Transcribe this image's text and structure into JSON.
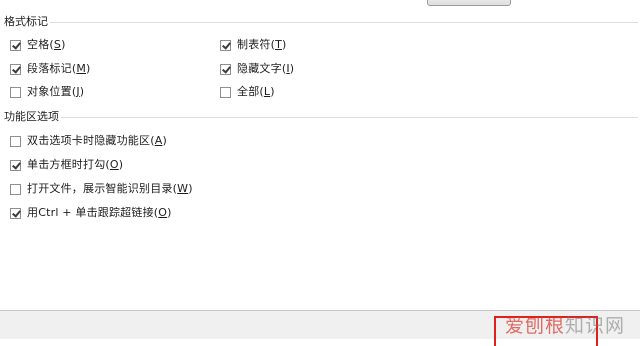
{
  "sections": {
    "format_marks": {
      "title": "格式标记",
      "options": [
        {
          "text": "空格",
          "key": "S",
          "checked": true
        },
        {
          "text": "制表符",
          "key": "T",
          "checked": true
        },
        {
          "text": "段落标记",
          "key": "M",
          "checked": true
        },
        {
          "text": "隐藏文字",
          "key": "I",
          "checked": true
        },
        {
          "text": "对象位置",
          "key": "J",
          "checked": false
        },
        {
          "text": "全部",
          "key": "L",
          "checked": false
        }
      ]
    },
    "feature_options": {
      "title": "功能区选项",
      "options": [
        {
          "text": "双击选项卡时隐藏功能区",
          "key": "A",
          "checked": false
        },
        {
          "text": "单击方框时打勾",
          "key": "O",
          "checked": true
        },
        {
          "text": "打开文件，展示智能识别目录",
          "key": "W",
          "checked": false
        },
        {
          "text": "用Ctrl + 单击跟踪超链接",
          "key": "O",
          "checked": true
        }
      ]
    }
  },
  "watermark": {
    "part1": "爱刨根",
    "part2": "知识网"
  }
}
